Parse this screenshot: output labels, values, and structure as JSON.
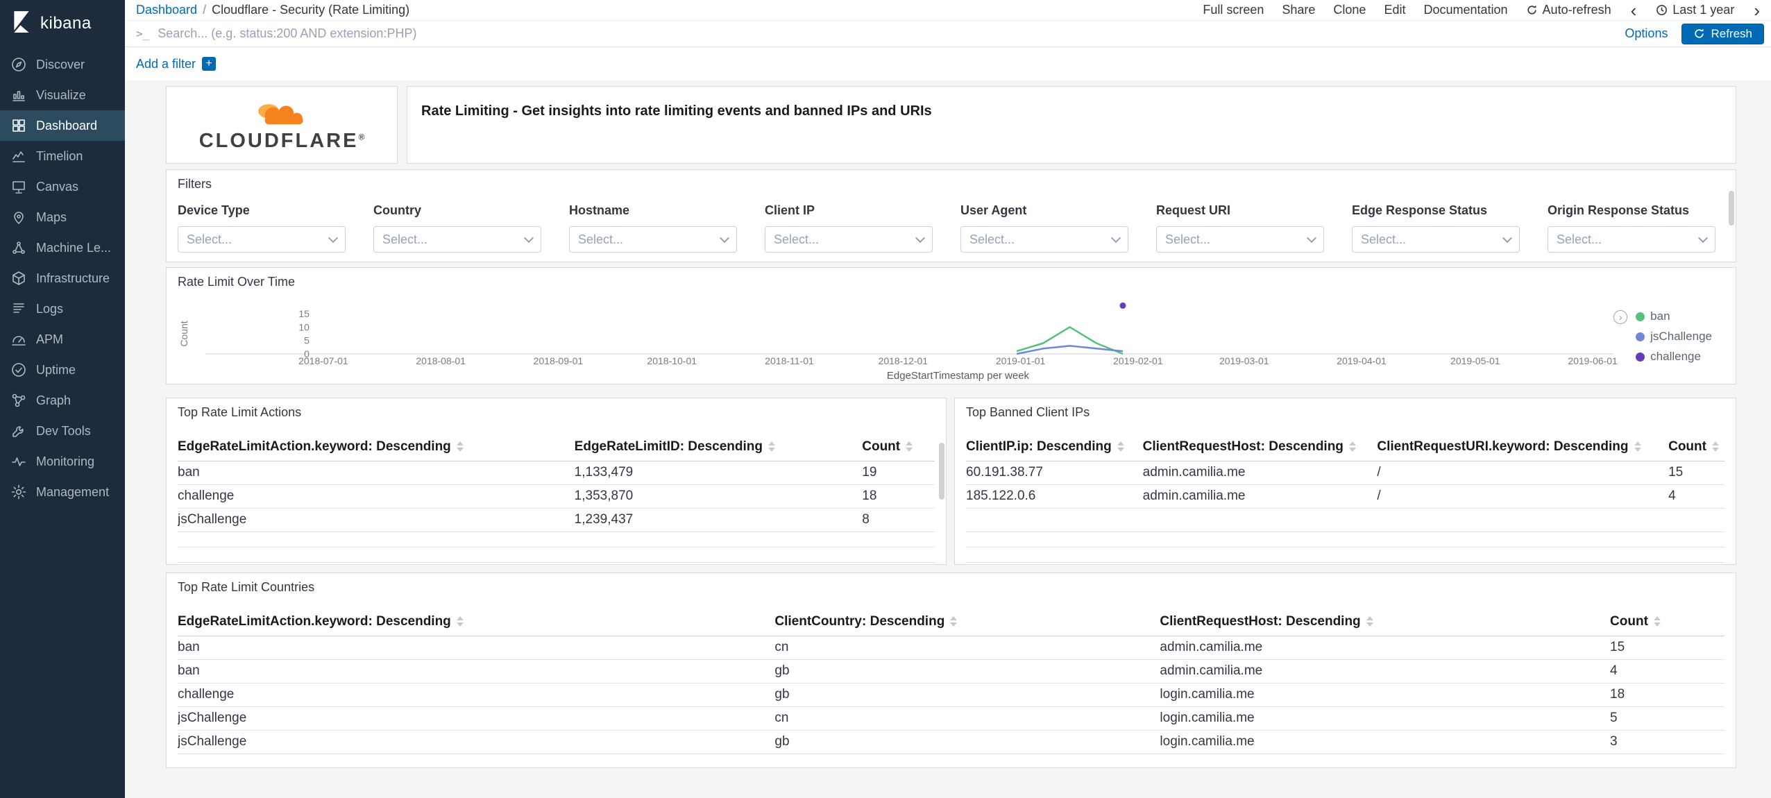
{
  "branding": {
    "logo_text": "kibana"
  },
  "sidebar": {
    "items": [
      {
        "label": "Discover",
        "icon": "discover-icon",
        "active": false
      },
      {
        "label": "Visualize",
        "icon": "visualize-icon",
        "active": false
      },
      {
        "label": "Dashboard",
        "icon": "dashboard-icon",
        "active": true
      },
      {
        "label": "Timelion",
        "icon": "timelion-icon",
        "active": false
      },
      {
        "label": "Canvas",
        "icon": "canvas-icon",
        "active": false
      },
      {
        "label": "Maps",
        "icon": "maps-icon",
        "active": false
      },
      {
        "label": "Machine Le...",
        "icon": "machine-learning-icon",
        "active": false
      },
      {
        "label": "Infrastructure",
        "icon": "infrastructure-icon",
        "active": false
      },
      {
        "label": "Logs",
        "icon": "logs-icon",
        "active": false
      },
      {
        "label": "APM",
        "icon": "apm-icon",
        "active": false
      },
      {
        "label": "Uptime",
        "icon": "uptime-icon",
        "active": false
      },
      {
        "label": "Graph",
        "icon": "graph-icon",
        "active": false
      },
      {
        "label": "Dev Tools",
        "icon": "dev-tools-icon",
        "active": false
      },
      {
        "label": "Monitoring",
        "icon": "monitoring-icon",
        "active": false
      },
      {
        "label": "Management",
        "icon": "management-icon",
        "active": false
      }
    ]
  },
  "breadcrumb": {
    "root": "Dashboard",
    "separator": "/",
    "current": "Cloudflare - Security (Rate Limiting)"
  },
  "top_menu": {
    "items": [
      "Full screen",
      "Share",
      "Clone",
      "Edit",
      "Documentation"
    ],
    "auto_refresh": "Auto-refresh",
    "prev_arrow": "‹",
    "time_range": "Last 1 year",
    "next_arrow": "›"
  },
  "query_bar": {
    "prompt": ">_",
    "placeholder": "Search... (e.g. status:200 AND extension:PHP)",
    "options_label": "Options",
    "refresh_label": "Refresh"
  },
  "filter_bar": {
    "add_filter_label": "Add a filter",
    "plus": "+"
  },
  "panels": {
    "cloudflare_logo_text": "CLOUDFLARE",
    "cloudflare_reg": "®",
    "header_title": "Rate Limiting - Get insights into rate limiting events and banned IPs and URIs",
    "filters": {
      "title": "Filters",
      "fields": [
        {
          "label": "Device Type",
          "placeholder": "Select..."
        },
        {
          "label": "Country",
          "placeholder": "Select..."
        },
        {
          "label": "Hostname",
          "placeholder": "Select..."
        },
        {
          "label": "Client IP",
          "placeholder": "Select..."
        },
        {
          "label": "User Agent",
          "placeholder": "Select..."
        },
        {
          "label": "Request URI",
          "placeholder": "Select..."
        },
        {
          "label": "Edge Response Status",
          "placeholder": "Select..."
        },
        {
          "label": "Origin Response Status",
          "placeholder": "Select..."
        }
      ]
    },
    "chart_panel_title": "Rate Limit Over Time",
    "tables": {
      "actions": {
        "title": "Top Rate Limit Actions",
        "columns": [
          "EdgeRateLimitAction.keyword: Descending",
          "EdgeRateLimitID: Descending",
          "Count"
        ],
        "rows": [
          [
            "ban",
            "1,133,479",
            "19"
          ],
          [
            "challenge",
            "1,353,870",
            "18"
          ],
          [
            "jsChallenge",
            "1,239,437",
            "8"
          ]
        ]
      },
      "banned_ips": {
        "title": "Top Banned Client IPs",
        "columns": [
          "ClientIP.ip: Descending",
          "ClientRequestHost: Descending",
          "ClientRequestURI.keyword: Descending",
          "Count"
        ],
        "rows": [
          [
            "60.191.38.77",
            "admin.camilia.me",
            "/",
            "15"
          ],
          [
            "185.122.0.6",
            "admin.camilia.me",
            "/",
            "4"
          ]
        ]
      },
      "countries": {
        "title": "Top Rate Limit Countries",
        "columns": [
          "EdgeRateLimitAction.keyword: Descending",
          "ClientCountry: Descending",
          "ClientRequestHost: Descending",
          "Count"
        ],
        "rows": [
          [
            "ban",
            "cn",
            "admin.camilia.me",
            "15"
          ],
          [
            "ban",
            "gb",
            "admin.camilia.me",
            "4"
          ],
          [
            "challenge",
            "gb",
            "login.camilia.me",
            "18"
          ],
          [
            "jsChallenge",
            "cn",
            "login.camilia.me",
            "5"
          ],
          [
            "jsChallenge",
            "gb",
            "login.camilia.me",
            "3"
          ]
        ]
      }
    }
  },
  "chart_data": {
    "type": "line",
    "title": "Rate Limit Over Time",
    "xlabel": "EdgeStartTimestamp per week",
    "ylabel": "Count",
    "ylim": [
      0,
      15
    ],
    "yticks": [
      0,
      5,
      10,
      15
    ],
    "xticks": [
      "2018-07-01",
      "2018-08-01",
      "2018-09-01",
      "2018-10-01",
      "2018-11-01",
      "2018-12-01",
      "2019-01-01",
      "2019-02-01",
      "2019-03-01",
      "2019-04-01",
      "2019-05-01",
      "2019-06-01"
    ],
    "legend_position": "right",
    "grid": false,
    "series": [
      {
        "name": "ban",
        "color": "#57c17b",
        "points": [
          [
            "2018-12-31",
            1
          ],
          [
            "2019-01-07",
            4
          ],
          [
            "2019-01-14",
            10
          ],
          [
            "2019-01-21",
            4
          ],
          [
            "2019-01-28",
            0
          ]
        ]
      },
      {
        "name": "jsChallenge",
        "color": "#6f87d8",
        "points": [
          [
            "2018-12-31",
            0
          ],
          [
            "2019-01-07",
            2
          ],
          [
            "2019-01-14",
            3
          ],
          [
            "2019-01-21",
            2
          ],
          [
            "2019-01-28",
            1
          ]
        ]
      },
      {
        "name": "challenge",
        "color": "#663db8",
        "points": [
          [
            "2019-01-28",
            18
          ]
        ]
      }
    ]
  }
}
